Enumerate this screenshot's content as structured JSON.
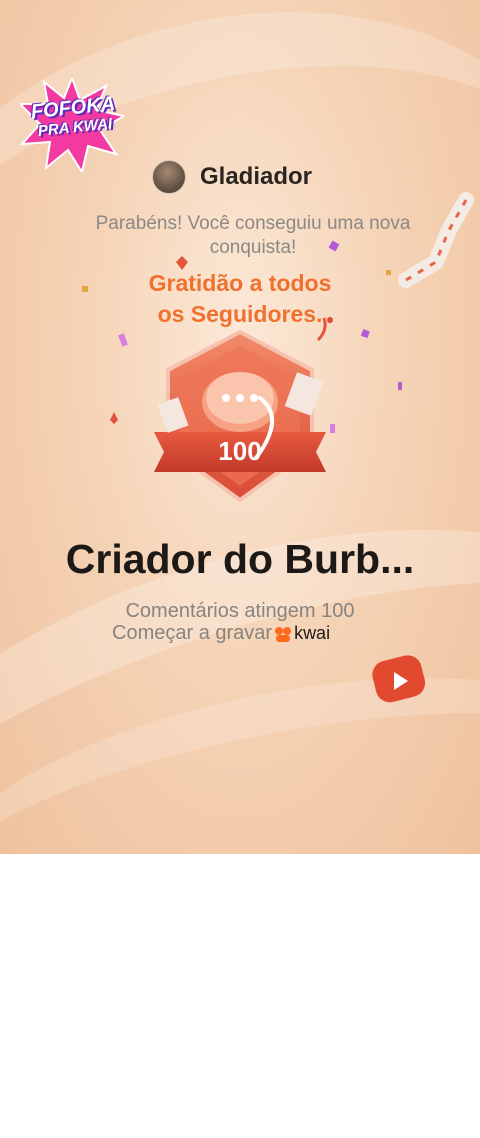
{
  "logo": {
    "line1": "FOFOKA",
    "line2": "PRA KWAI"
  },
  "user": {
    "name": "Gladiador"
  },
  "message": {
    "congrats": "Parabéns! Você conseguiu uma nova conquista!"
  },
  "overlay": {
    "line1": "Gratidão  a todos",
    "line2": "os Seguidores."
  },
  "badge": {
    "number": "100",
    "icon": "chat-bubble-icon"
  },
  "achievement": {
    "title": "Criador do Burb...",
    "description": "Comentários atingem 100",
    "record_label": "Começar a gravar",
    "brand": "kwai"
  },
  "colors": {
    "accent": "#f0712f",
    "badge_red": "#e4553a",
    "brand_orange": "#ff6a1f"
  }
}
